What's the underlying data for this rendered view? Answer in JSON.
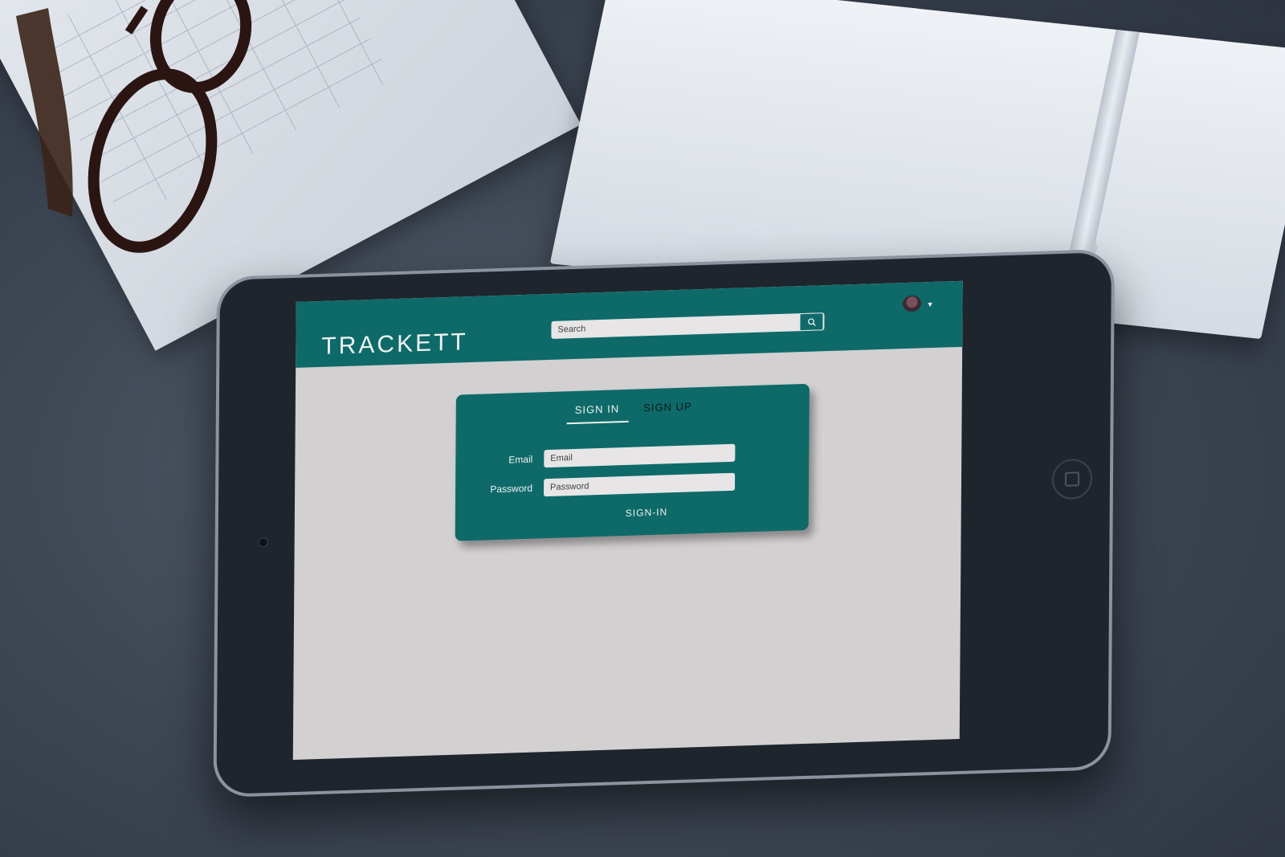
{
  "header": {
    "logo_text": "TRACKETT",
    "search_placeholder": "Search",
    "search_icon": "search-icon",
    "user_menu_icon": "caret-down-icon"
  },
  "auth_card": {
    "tabs": [
      {
        "label": "SIGN IN",
        "active": true
      },
      {
        "label": "SIGN UP",
        "active": false
      }
    ],
    "email_label": "Email",
    "email_placeholder": "Email",
    "password_label": "Password",
    "password_placeholder": "Password",
    "submit_label": "SIGN-IN"
  },
  "colors": {
    "accent": "#0e6a69",
    "page_background": "#d3d0d1",
    "field_background": "#e7e5e6"
  }
}
